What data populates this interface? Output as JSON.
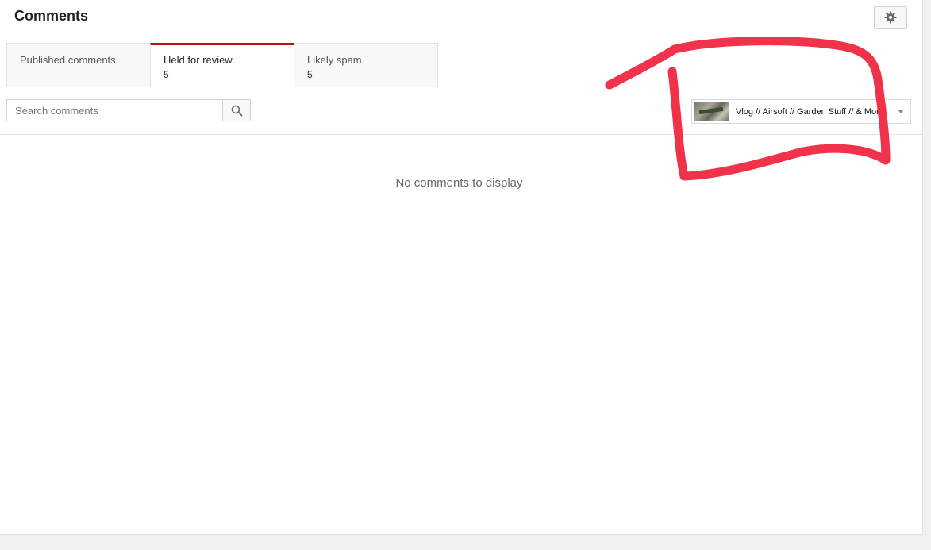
{
  "header": {
    "title": "Comments"
  },
  "toolbar": {
    "settings_icon": "gear-icon"
  },
  "tabs": [
    {
      "label": "Published comments",
      "count": ""
    },
    {
      "label": "Held for review",
      "count": "5"
    },
    {
      "label": "Likely spam",
      "count": "5"
    }
  ],
  "search": {
    "placeholder": "Search comments",
    "value": "",
    "button_icon": "search-icon"
  },
  "video_filter": {
    "selected_title": "Vlog // Airsoft // Garden Stuff // & More!",
    "thumbnail_icon": "video-thumbnail",
    "dropdown_icon": "caret-down-icon"
  },
  "main": {
    "empty_message": "No comments to display"
  },
  "colors": {
    "active_tab_accent": "#b31217",
    "annotation_red": "#f0334a"
  },
  "annotation": {
    "type": "hand-drawn-circle",
    "color_name": "red"
  }
}
